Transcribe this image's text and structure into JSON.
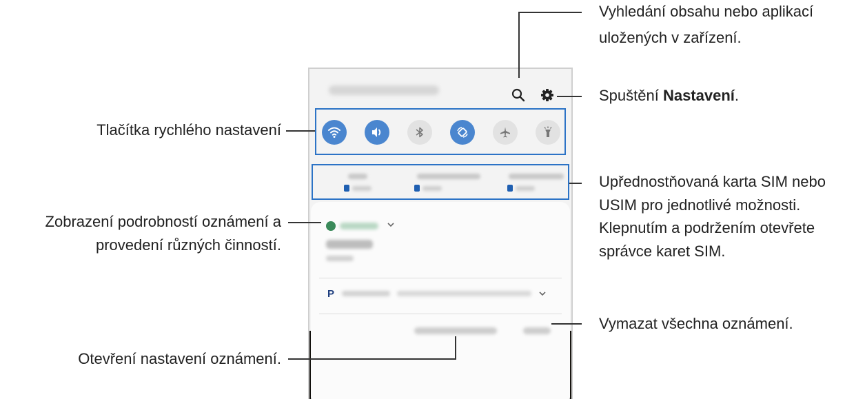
{
  "annotations": {
    "search": {
      "line1": "Vyhledání obsahu nebo aplikací",
      "line2": "uložených v zařízení."
    },
    "settings": {
      "prefix": "Spuštění ",
      "bold": "Nastavení",
      "suffix": "."
    },
    "quick_settings": "Tlačítka rychlého nastavení",
    "sim": {
      "line1": "Upřednostňovaná karta SIM nebo",
      "line2": "USIM pro jednotlivé možnosti.",
      "line3": "Klepnutím a podržením otevřete",
      "line4": "správce karet SIM."
    },
    "notification_details": {
      "line1": "Zobrazení podrobností oznámení a",
      "line2": "provedení různých činností."
    },
    "clear_all": "Vymazat všechna oznámení.",
    "notification_settings": "Otevření nastavení oznámení."
  },
  "quick_settings_buttons": [
    {
      "name": "wifi",
      "state": "on"
    },
    {
      "name": "sound",
      "state": "on"
    },
    {
      "name": "bluetooth",
      "state": "off"
    },
    {
      "name": "auto-rotate",
      "state": "on"
    },
    {
      "name": "airplane-mode",
      "state": "off"
    },
    {
      "name": "flashlight",
      "state": "off"
    }
  ],
  "colors": {
    "accent": "#4a86cf",
    "highlight_box": "#2c73c6",
    "sim_chip": "#1f5fb1",
    "notification_app": "#3a8a5a"
  },
  "icons": {
    "search": "search-icon",
    "settings": "gear-icon"
  }
}
